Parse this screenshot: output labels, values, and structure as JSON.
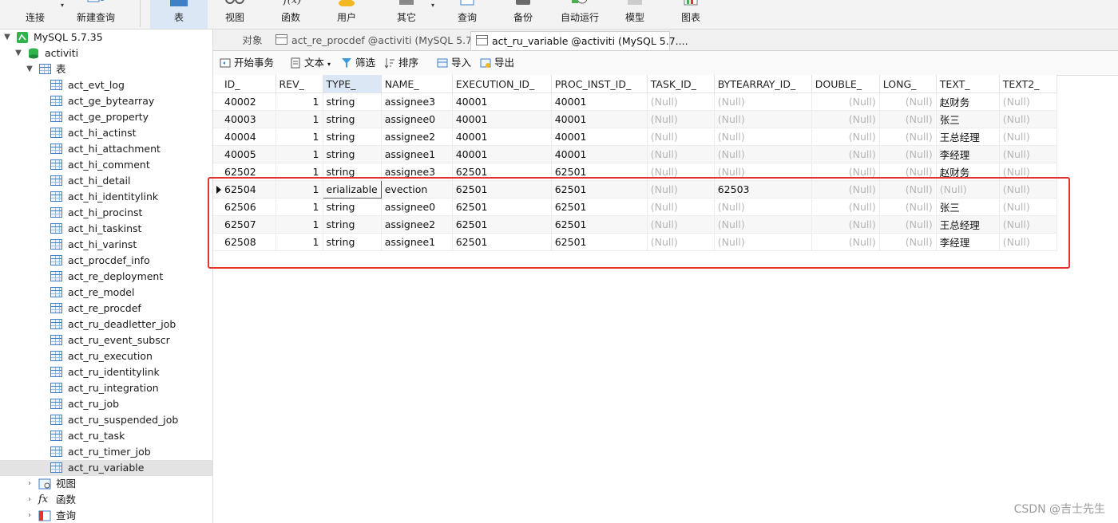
{
  "toolbar": {
    "buttons": [
      {
        "label": "连接",
        "icon": "plug-icon"
      },
      {
        "label": "新建查询",
        "icon": "new-query-icon"
      },
      {
        "label": "表",
        "icon": "table-icon"
      },
      {
        "label": "视图",
        "icon": "view-icon"
      },
      {
        "label": "函数",
        "icon": "function-icon"
      },
      {
        "label": "用户",
        "icon": "user-icon"
      },
      {
        "label": "其它",
        "icon": "other-icon"
      },
      {
        "label": "查询",
        "icon": "query-icon"
      },
      {
        "label": "备份",
        "icon": "backup-icon"
      },
      {
        "label": "自动运行",
        "icon": "auto-run-icon"
      },
      {
        "label": "模型",
        "icon": "model-icon"
      },
      {
        "label": "图表",
        "icon": "chart-icon"
      }
    ]
  },
  "sidebar": {
    "connection": "MySQL 5.7.35",
    "database": "activiti",
    "tables_group": "表",
    "tables": [
      "act_evt_log",
      "act_ge_bytearray",
      "act_ge_property",
      "act_hi_actinst",
      "act_hi_attachment",
      "act_hi_comment",
      "act_hi_detail",
      "act_hi_identitylink",
      "act_hi_procinst",
      "act_hi_taskinst",
      "act_hi_varinst",
      "act_procdef_info",
      "act_re_deployment",
      "act_re_model",
      "act_re_procdef",
      "act_ru_deadletter_job",
      "act_ru_event_subscr",
      "act_ru_execution",
      "act_ru_identitylink",
      "act_ru_integration",
      "act_ru_job",
      "act_ru_suspended_job",
      "act_ru_task",
      "act_ru_timer_job",
      "act_ru_variable"
    ],
    "selected_table": "act_ru_variable",
    "groups": [
      "视图",
      "函数",
      "查询"
    ]
  },
  "tabs": [
    "对象",
    "act_re_procdef @activiti (MySQL 5.7....",
    "act_ru_variable @activiti (MySQL 5.7...."
  ],
  "gridbar": {
    "begin_tx": "开始事务",
    "text": "文本",
    "filter": "筛选",
    "sort": "排序",
    "import": "导入",
    "export": "导出"
  },
  "grid": {
    "columns": [
      "ID_",
      "REV_",
      "TYPE_",
      "NAME_",
      "EXECUTION_ID_",
      "PROC_INST_ID_",
      "TASK_ID_",
      "BYTEARRAY_ID_",
      "DOUBLE_",
      "LONG_",
      "TEXT_",
      "TEXT2_"
    ],
    "rows": [
      [
        "40002",
        "1",
        "string",
        "assignee3",
        "40001",
        "40001",
        "(Null)",
        "(Null)",
        "(Null)",
        "(Null)",
        "赵财务",
        "(Null)"
      ],
      [
        "40003",
        "1",
        "string",
        "assignee0",
        "40001",
        "40001",
        "(Null)",
        "(Null)",
        "(Null)",
        "(Null)",
        "张三",
        "(Null)"
      ],
      [
        "40004",
        "1",
        "string",
        "assignee2",
        "40001",
        "40001",
        "(Null)",
        "(Null)",
        "(Null)",
        "(Null)",
        "王总经理",
        "(Null)"
      ],
      [
        "40005",
        "1",
        "string",
        "assignee1",
        "40001",
        "40001",
        "(Null)",
        "(Null)",
        "(Null)",
        "(Null)",
        "李经理",
        "(Null)"
      ],
      [
        "62502",
        "1",
        "string",
        "assignee3",
        "62501",
        "62501",
        "(Null)",
        "(Null)",
        "(Null)",
        "(Null)",
        "赵财务",
        "(Null)"
      ],
      [
        "62504",
        "1",
        "erializable",
        "evection",
        "62501",
        "62501",
        "(Null)",
        "62503",
        "(Null)",
        "(Null)",
        "(Null)",
        "(Null)"
      ],
      [
        "62506",
        "1",
        "string",
        "assignee0",
        "62501",
        "62501",
        "(Null)",
        "(Null)",
        "(Null)",
        "(Null)",
        "张三",
        "(Null)"
      ],
      [
        "62507",
        "1",
        "string",
        "assignee2",
        "62501",
        "62501",
        "(Null)",
        "(Null)",
        "(Null)",
        "(Null)",
        "王总经理",
        "(Null)"
      ],
      [
        "62508",
        "1",
        "string",
        "assignee1",
        "62501",
        "62501",
        "(Null)",
        "(Null)",
        "(Null)",
        "(Null)",
        "李经理",
        "(Null)"
      ]
    ]
  },
  "watermark": "CSDN @吉士先生",
  "colors": {
    "highlight_box": "#e5332d",
    "selected_header": "#dbe7f5"
  }
}
